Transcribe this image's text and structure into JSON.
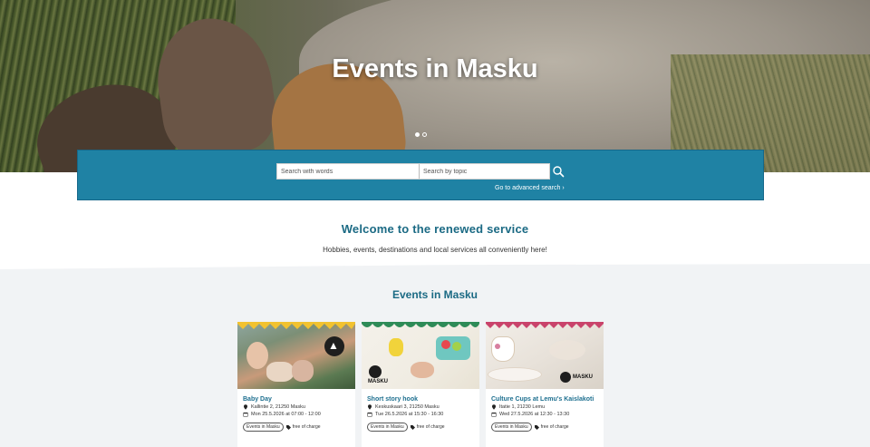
{
  "hero": {
    "title": "Events in Masku",
    "slides_total": 2,
    "active_slide": 1
  },
  "search": {
    "words_placeholder": "Search with words",
    "topic_placeholder": "Search by topic",
    "advanced_label": "Go to advanced search",
    "icon": "search-icon"
  },
  "welcome": {
    "title": "Welcome to the renewed service",
    "subtitle": "Hobbies, events, destinations and local services all conveniently here!"
  },
  "events": {
    "title": "Events in Masku",
    "cards": [
      {
        "name": "Baby Day",
        "address": "Kallintie 2, 21250 Masku",
        "datetime": "Mon 25.5.2026 at 07:00 - 12:00",
        "tag": "Events in Masku",
        "price": "free of charge",
        "bunting_color": "#f2c230"
      },
      {
        "name": "Short story hook",
        "address": "Keskuskaari 3, 21250 Masku",
        "datetime": "Tue 26.5.2026 at 15:30 - 16:30",
        "tag": "Events in Masku",
        "price": "free of charge",
        "bunting_color": "#2e8b57",
        "logo_text": "MASKU"
      },
      {
        "name": "Culture Cups at Lemu's Kaislakoti",
        "address": "Itatie 1, 21230 Lemu",
        "datetime": "Wed 27.5.2026 at 12:30 - 13:30",
        "tag": "Events in Masku",
        "price": "free of charge",
        "bunting_color": "#c9436b",
        "logo_text": "MASKU"
      }
    ]
  },
  "colors": {
    "brand_blue": "#1f82a4",
    "heading_teal": "#1b6a84",
    "section_bg": "#f1f3f5"
  }
}
